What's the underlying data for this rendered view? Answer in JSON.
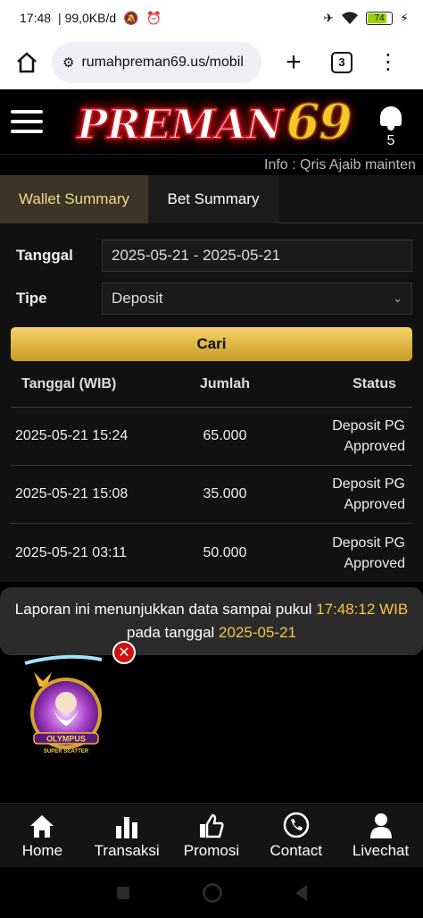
{
  "status_bar": {
    "time": "17:48",
    "speed": "99,0KB/d",
    "battery": "74"
  },
  "browser": {
    "url": "rumahpreman69.us/mobil",
    "tabs_count": "3"
  },
  "header": {
    "logo_text": "PREMAN",
    "logo_number": "69",
    "notification_count": "5"
  },
  "marquee": "Info : Qris Ajaib mainten",
  "tabs": [
    {
      "label": "Wallet Summary"
    },
    {
      "label": "Bet Summary"
    }
  ],
  "filters": {
    "date_label": "Tanggal",
    "date_value": "2025-05-21 - 2025-05-21",
    "type_label": "Tipe",
    "type_value": "Deposit",
    "search_label": "Cari"
  },
  "table": {
    "headers": [
      "Tanggal (WIB)",
      "Jumlah",
      "Status"
    ],
    "rows": [
      {
        "date": "2025-05-21 15:24",
        "amount": "65.000",
        "status1": "Deposit PG",
        "status2": "Approved"
      },
      {
        "date": "2025-05-21 15:08",
        "amount": "35.000",
        "status1": "Deposit PG",
        "status2": "Approved"
      },
      {
        "date": "2025-05-21 03:11",
        "amount": "50.000",
        "status1": "Deposit PG",
        "status2": "Approved"
      }
    ]
  },
  "report": {
    "part1": "Laporan ini menunjukkan data sampai pukul ",
    "time": "17:48:12",
    "part2": "WIB",
    "part3": " pada tanggal ",
    "date": "2025-05-21"
  },
  "game_banner": {
    "line1": "OLYMPUS",
    "line2": "SUPER SCATTER"
  },
  "bottom_nav": [
    {
      "label": "Home",
      "icon": "home-icon"
    },
    {
      "label": "Transaksi",
      "icon": "bar-chart-icon"
    },
    {
      "label": "Promosi",
      "icon": "thumbs-up-icon"
    },
    {
      "label": "Contact",
      "icon": "phone-icon"
    },
    {
      "label": "Livechat",
      "icon": "person-icon"
    }
  ],
  "colors": {
    "accent_gold": "#f4c542",
    "active_tab_bg": "#3c3426",
    "logo_red": "#c4121b"
  }
}
